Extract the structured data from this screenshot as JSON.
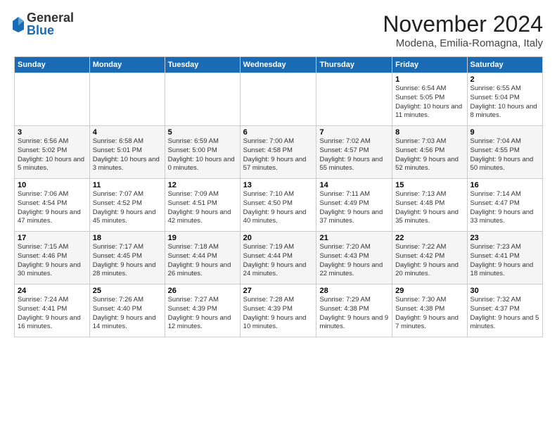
{
  "logo": {
    "general": "General",
    "blue": "Blue"
  },
  "title": "November 2024",
  "location": "Modena, Emilia-Romagna, Italy",
  "days_of_week": [
    "Sunday",
    "Monday",
    "Tuesday",
    "Wednesday",
    "Thursday",
    "Friday",
    "Saturday"
  ],
  "weeks": [
    [
      {
        "day": "",
        "sunrise": "",
        "sunset": "",
        "daylight": ""
      },
      {
        "day": "",
        "sunrise": "",
        "sunset": "",
        "daylight": ""
      },
      {
        "day": "",
        "sunrise": "",
        "sunset": "",
        "daylight": ""
      },
      {
        "day": "",
        "sunrise": "",
        "sunset": "",
        "daylight": ""
      },
      {
        "day": "",
        "sunrise": "",
        "sunset": "",
        "daylight": ""
      },
      {
        "day": "1",
        "sunrise": "Sunrise: 6:54 AM",
        "sunset": "Sunset: 5:05 PM",
        "daylight": "Daylight: 10 hours and 11 minutes."
      },
      {
        "day": "2",
        "sunrise": "Sunrise: 6:55 AM",
        "sunset": "Sunset: 5:04 PM",
        "daylight": "Daylight: 10 hours and 8 minutes."
      }
    ],
    [
      {
        "day": "3",
        "sunrise": "Sunrise: 6:56 AM",
        "sunset": "Sunset: 5:02 PM",
        "daylight": "Daylight: 10 hours and 5 minutes."
      },
      {
        "day": "4",
        "sunrise": "Sunrise: 6:58 AM",
        "sunset": "Sunset: 5:01 PM",
        "daylight": "Daylight: 10 hours and 3 minutes."
      },
      {
        "day": "5",
        "sunrise": "Sunrise: 6:59 AM",
        "sunset": "Sunset: 5:00 PM",
        "daylight": "Daylight: 10 hours and 0 minutes."
      },
      {
        "day": "6",
        "sunrise": "Sunrise: 7:00 AM",
        "sunset": "Sunset: 4:58 PM",
        "daylight": "Daylight: 9 hours and 57 minutes."
      },
      {
        "day": "7",
        "sunrise": "Sunrise: 7:02 AM",
        "sunset": "Sunset: 4:57 PM",
        "daylight": "Daylight: 9 hours and 55 minutes."
      },
      {
        "day": "8",
        "sunrise": "Sunrise: 7:03 AM",
        "sunset": "Sunset: 4:56 PM",
        "daylight": "Daylight: 9 hours and 52 minutes."
      },
      {
        "day": "9",
        "sunrise": "Sunrise: 7:04 AM",
        "sunset": "Sunset: 4:55 PM",
        "daylight": "Daylight: 9 hours and 50 minutes."
      }
    ],
    [
      {
        "day": "10",
        "sunrise": "Sunrise: 7:06 AM",
        "sunset": "Sunset: 4:54 PM",
        "daylight": "Daylight: 9 hours and 47 minutes."
      },
      {
        "day": "11",
        "sunrise": "Sunrise: 7:07 AM",
        "sunset": "Sunset: 4:52 PM",
        "daylight": "Daylight: 9 hours and 45 minutes."
      },
      {
        "day": "12",
        "sunrise": "Sunrise: 7:09 AM",
        "sunset": "Sunset: 4:51 PM",
        "daylight": "Daylight: 9 hours and 42 minutes."
      },
      {
        "day": "13",
        "sunrise": "Sunrise: 7:10 AM",
        "sunset": "Sunset: 4:50 PM",
        "daylight": "Daylight: 9 hours and 40 minutes."
      },
      {
        "day": "14",
        "sunrise": "Sunrise: 7:11 AM",
        "sunset": "Sunset: 4:49 PM",
        "daylight": "Daylight: 9 hours and 37 minutes."
      },
      {
        "day": "15",
        "sunrise": "Sunrise: 7:13 AM",
        "sunset": "Sunset: 4:48 PM",
        "daylight": "Daylight: 9 hours and 35 minutes."
      },
      {
        "day": "16",
        "sunrise": "Sunrise: 7:14 AM",
        "sunset": "Sunset: 4:47 PM",
        "daylight": "Daylight: 9 hours and 33 minutes."
      }
    ],
    [
      {
        "day": "17",
        "sunrise": "Sunrise: 7:15 AM",
        "sunset": "Sunset: 4:46 PM",
        "daylight": "Daylight: 9 hours and 30 minutes."
      },
      {
        "day": "18",
        "sunrise": "Sunrise: 7:17 AM",
        "sunset": "Sunset: 4:45 PM",
        "daylight": "Daylight: 9 hours and 28 minutes."
      },
      {
        "day": "19",
        "sunrise": "Sunrise: 7:18 AM",
        "sunset": "Sunset: 4:44 PM",
        "daylight": "Daylight: 9 hours and 26 minutes."
      },
      {
        "day": "20",
        "sunrise": "Sunrise: 7:19 AM",
        "sunset": "Sunset: 4:44 PM",
        "daylight": "Daylight: 9 hours and 24 minutes."
      },
      {
        "day": "21",
        "sunrise": "Sunrise: 7:20 AM",
        "sunset": "Sunset: 4:43 PM",
        "daylight": "Daylight: 9 hours and 22 minutes."
      },
      {
        "day": "22",
        "sunrise": "Sunrise: 7:22 AM",
        "sunset": "Sunset: 4:42 PM",
        "daylight": "Daylight: 9 hours and 20 minutes."
      },
      {
        "day": "23",
        "sunrise": "Sunrise: 7:23 AM",
        "sunset": "Sunset: 4:41 PM",
        "daylight": "Daylight: 9 hours and 18 minutes."
      }
    ],
    [
      {
        "day": "24",
        "sunrise": "Sunrise: 7:24 AM",
        "sunset": "Sunset: 4:41 PM",
        "daylight": "Daylight: 9 hours and 16 minutes."
      },
      {
        "day": "25",
        "sunrise": "Sunrise: 7:26 AM",
        "sunset": "Sunset: 4:40 PM",
        "daylight": "Daylight: 9 hours and 14 minutes."
      },
      {
        "day": "26",
        "sunrise": "Sunrise: 7:27 AM",
        "sunset": "Sunset: 4:39 PM",
        "daylight": "Daylight: 9 hours and 12 minutes."
      },
      {
        "day": "27",
        "sunrise": "Sunrise: 7:28 AM",
        "sunset": "Sunset: 4:39 PM",
        "daylight": "Daylight: 9 hours and 10 minutes."
      },
      {
        "day": "28",
        "sunrise": "Sunrise: 7:29 AM",
        "sunset": "Sunset: 4:38 PM",
        "daylight": "Daylight: 9 hours and 9 minutes."
      },
      {
        "day": "29",
        "sunrise": "Sunrise: 7:30 AM",
        "sunset": "Sunset: 4:38 PM",
        "daylight": "Daylight: 9 hours and 7 minutes."
      },
      {
        "day": "30",
        "sunrise": "Sunrise: 7:32 AM",
        "sunset": "Sunset: 4:37 PM",
        "daylight": "Daylight: 9 hours and 5 minutes."
      }
    ]
  ]
}
